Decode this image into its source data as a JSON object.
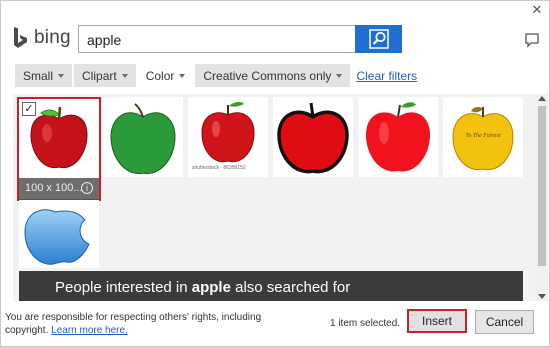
{
  "window": {
    "close_glyph": "✕"
  },
  "header": {
    "logo_text": "bing",
    "search_value": "apple",
    "search_icon": "search-icon",
    "feedback_icon": "comment-icon"
  },
  "filters": {
    "size": "Small",
    "type": "Clipart",
    "color": "Color",
    "license": "Creative Commons only",
    "clear": "Clear filters"
  },
  "results": {
    "selected_size_label": "100 x 100...",
    "info_glyph": "i",
    "check_glyph": "✓",
    "watermark": "shutterstock · 86399152",
    "golden_text": "To The Fairest",
    "related_prefix": "People interested in ",
    "related_term": "apple",
    "related_suffix": " also searched for"
  },
  "footer": {
    "disclaimer": "You are responsible for respecting others' rights, including copyright.",
    "learn_more": "Learn more here.",
    "selected_count": "1 item selected.",
    "insert_label": "Insert",
    "cancel_label": "Cancel"
  },
  "colors": {
    "accent_blue": "#1f6fd1",
    "selection_red": "#c8202a",
    "link_blue": "#1f5fbf"
  }
}
